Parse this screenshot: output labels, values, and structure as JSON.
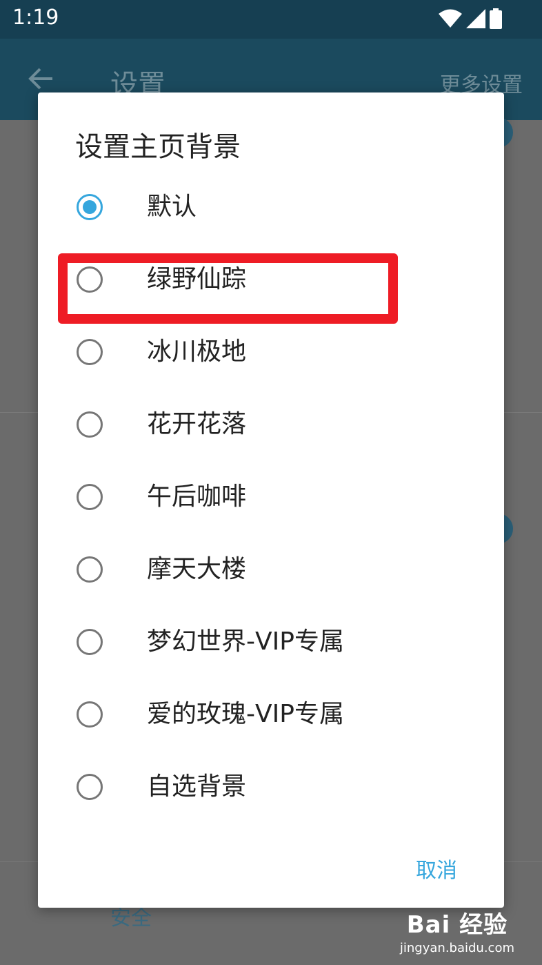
{
  "status_bar": {
    "time": "1:19"
  },
  "app_bar": {
    "title": "设置",
    "more_label": "更多设置"
  },
  "background": {
    "security_label": "安全"
  },
  "dialog": {
    "title": "设置主页背景",
    "options": [
      {
        "label": "默认",
        "selected": true
      },
      {
        "label": "绿野仙踪",
        "selected": false
      },
      {
        "label": "冰川极地",
        "selected": false
      },
      {
        "label": "花开花落",
        "selected": false
      },
      {
        "label": "午后咖啡",
        "selected": false
      },
      {
        "label": "摩天大楼",
        "selected": false
      },
      {
        "label": "梦幻世界-VIP专属",
        "selected": false
      },
      {
        "label": "爱的玫瑰-VIP专属",
        "selected": false
      },
      {
        "label": "自选背景",
        "selected": false
      }
    ],
    "cancel_label": "取消"
  },
  "watermark": {
    "logo": "Bai 经验",
    "url": "jingyan.baidu.com"
  },
  "colors": {
    "accent": "#35a6dd",
    "highlight": "#ee1c25",
    "status_bar": "#163f52"
  }
}
